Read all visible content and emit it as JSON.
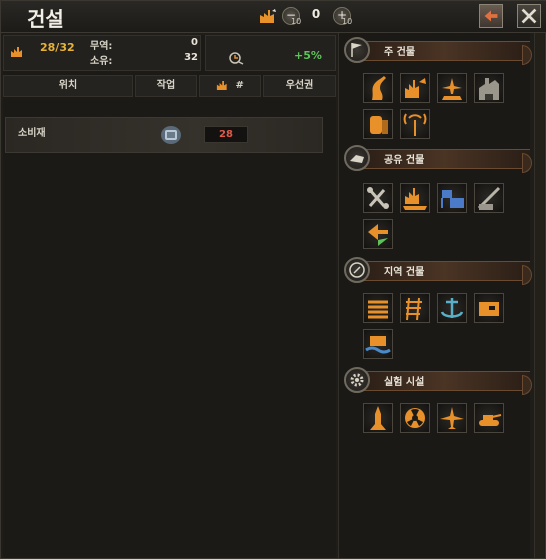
{
  "header": {
    "title": "건설",
    "counter_value": "0",
    "stepper_left_sub": "10",
    "stepper_right_sub": "10"
  },
  "stats": {
    "factories": "28/32",
    "trade_label": "무역:",
    "trade_value": "0",
    "owned_label": "소유:",
    "owned_value": "32",
    "bonus": "+5%"
  },
  "columns": {
    "location": "위치",
    "action": "작업",
    "factory_count": "#",
    "priority": "우선권"
  },
  "queue": [
    {
      "label": "소비재",
      "value": "28",
      "icon": "consumer-goods-icon"
    }
  ],
  "categories": [
    {
      "label": "주 건물",
      "icon": "flag-icon",
      "buildings": [
        "infrastructure-icon",
        "civilian-factory-icon",
        "air-base-icon",
        "military-factory-icon",
        "fuel-silo-icon",
        "radar-station-icon"
      ]
    },
    {
      "label": "공유 건물",
      "icon": "shared-building-icon",
      "buildings": [
        "synthetic-refinery-icon",
        "dockyard-icon",
        "supply-hub-icon",
        "railway-gun-icon",
        "refinery-icon"
      ]
    },
    {
      "label": "지역 건물",
      "icon": "compass-icon",
      "buildings": [
        "bunker-icon",
        "railway-icon",
        "naval-base-icon",
        "land-fort-icon",
        "coastal-fort-icon"
      ]
    },
    {
      "label": "실험 시설",
      "icon": "gear-icon",
      "buildings": [
        "rocket-site-icon",
        "nuclear-reactor-icon",
        "air-facility-icon",
        "tank-facility-icon"
      ]
    }
  ],
  "colors": {
    "accent_orange": "#e8902a",
    "positive_green": "#5ec25a",
    "negative_red": "#e05a4a",
    "gold": "#e6b23a"
  }
}
